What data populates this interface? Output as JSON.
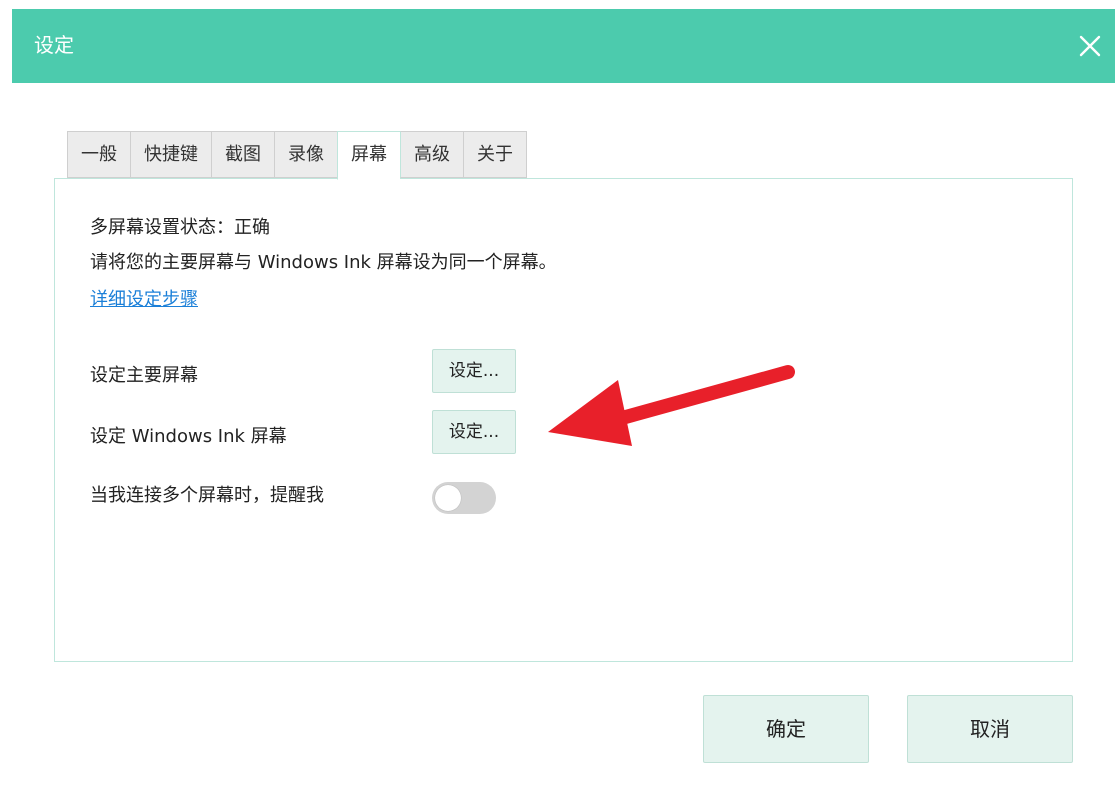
{
  "window": {
    "title": "设定"
  },
  "tabs": [
    {
      "label": "一般",
      "active": false
    },
    {
      "label": "快捷键",
      "active": false
    },
    {
      "label": "截图",
      "active": false
    },
    {
      "label": "录像",
      "active": false
    },
    {
      "label": "屏幕",
      "active": true
    },
    {
      "label": "高级",
      "active": false
    },
    {
      "label": "关于",
      "active": false
    }
  ],
  "screen": {
    "status_text": "多屏幕设置状态：正确",
    "instruction_text": "请将您的主要屏幕与 Windows Ink 屏幕设为同一个屏幕。",
    "details_link": "详细设定步骤",
    "primary_label": "设定主要屏幕",
    "primary_button": "设定...",
    "ink_label": "设定 Windows Ink 屏幕",
    "ink_button": "设定...",
    "remind_label": "当我连接多个屏幕时，提醒我",
    "remind_enabled": false
  },
  "footer": {
    "ok_label": "确定",
    "cancel_label": "取消"
  },
  "annotation": {
    "arrow_color": "#e8202a"
  },
  "colors": {
    "accent": "#4ccbad",
    "button_bg": "#e4f3ee",
    "link": "#1a7fd8"
  }
}
